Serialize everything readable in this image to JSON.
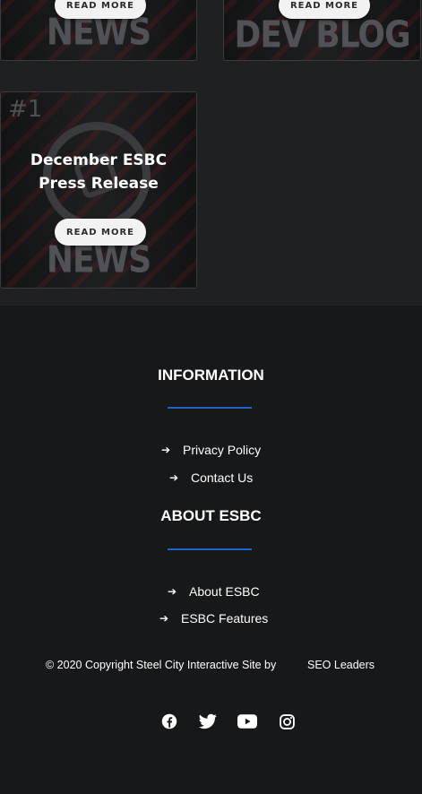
{
  "cards": [
    {
      "watermark": "NEWS UPDATE",
      "button": "READ MORE"
    },
    {
      "watermark": "DEV BLOG",
      "button": "READ MORE"
    },
    {
      "number": "#1",
      "title_line1": "December ESBC",
      "title_line2": "Press Release",
      "watermark": "NEWS UPDATE",
      "button": "READ MORE"
    }
  ],
  "information": {
    "heading": "INFORMATION",
    "links": [
      "Privacy Policy",
      "Contact Us"
    ]
  },
  "about": {
    "heading": "ABOUT ESBC",
    "links": [
      "About ESBC",
      "ESBC Features"
    ]
  },
  "footer": {
    "copyright": "© 2020 Copyright Steel City Interactive Site by",
    "credit": "SEO Leaders"
  },
  "social_icons": [
    "facebook-icon",
    "twitter-icon",
    "youtube-icon",
    "instagram-icon"
  ],
  "colors": {
    "accent": "#1e63c9",
    "background": "#17181a",
    "panel": "#1f2022"
  }
}
